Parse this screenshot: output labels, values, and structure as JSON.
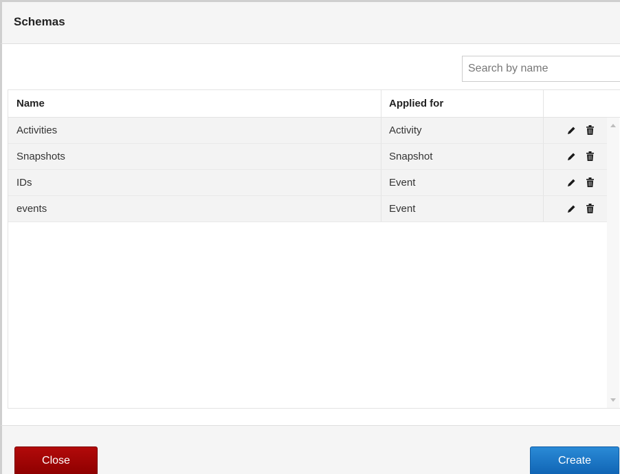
{
  "dialog": {
    "title": "Schemas"
  },
  "search": {
    "placeholder": "Search by name",
    "value": ""
  },
  "table": {
    "columns": {
      "name": "Name",
      "applied_for": "Applied for",
      "actions": ""
    },
    "rows": [
      {
        "name": "Activities",
        "applied_for": "Activity"
      },
      {
        "name": "Snapshots",
        "applied_for": "Snapshot"
      },
      {
        "name": "IDs",
        "applied_for": "Event"
      },
      {
        "name": "events",
        "applied_for": "Event"
      }
    ],
    "row_icons": [
      "pencil-icon",
      "trash-icon"
    ]
  },
  "footer": {
    "close_label": "Close",
    "create_label": "Create"
  },
  "colors": {
    "close_button": "#a00000",
    "create_button": "#1a73c4",
    "row_background": "#f3f3f3"
  }
}
